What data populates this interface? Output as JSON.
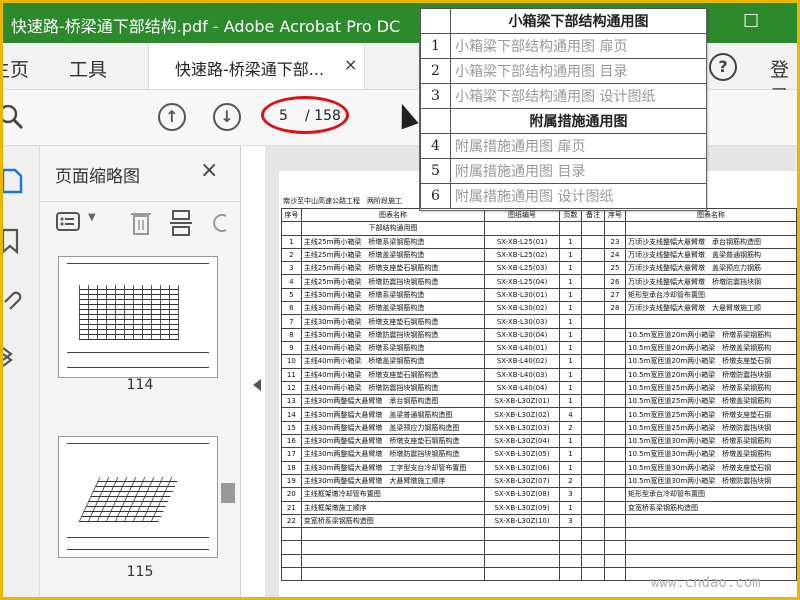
{
  "window": {
    "title": "快速路-桥梁通下部结构.pdf - Adobe Acrobat Pro DC",
    "maximize_glyph": "☐"
  },
  "tabs": {
    "home": "主页",
    "tools": "工具",
    "doc_tab": "快速路-桥梁通下部...",
    "doc_close": "×",
    "help": "?",
    "login": "登录"
  },
  "toolbar": {
    "zoom_icon": "search-icon",
    "current_page": "5",
    "total_pages": "/ 158"
  },
  "panel": {
    "title": "页面缩略图",
    "close": "×",
    "thumbnails": [
      {
        "page": "114"
      },
      {
        "page": "115"
      }
    ]
  },
  "overlay": {
    "rows": [
      {
        "num": "",
        "text": "小箱梁下部结构通用图",
        "section": true
      },
      {
        "num": "1",
        "text": "小箱梁下部结构通用图 扉页"
      },
      {
        "num": "2",
        "text": "小箱梁下部结构通用图 目录"
      },
      {
        "num": "3",
        "text": "小箱梁下部结构通用图 设计图纸"
      },
      {
        "num": "",
        "text": "附属措施通用图",
        "section": true
      },
      {
        "num": "4",
        "text": "附属措施通用图 扉页"
      },
      {
        "num": "5",
        "text": "附属措施通用图 目录"
      },
      {
        "num": "6",
        "text": "附属措施通用图 设计图纸"
      }
    ]
  },
  "doc": {
    "header_left": "南沙至中山高速公路工程　两阶段施工",
    "headers": [
      "序号",
      "图表名称",
      "图纸编号",
      "页数",
      "备注",
      "序号",
      "图表名称"
    ],
    "section_title": "下部结构通用图",
    "rows_left": [
      [
        "1",
        "主线25m两小箱梁　桥墩系梁钢筋构造",
        "SX-XB-L25(01)",
        "1"
      ],
      [
        "2",
        "主线25m两小箱梁　桥墩盖梁钢筋构造",
        "SX-XB-L25(02)",
        "1"
      ],
      [
        "3",
        "主线25m两小箱梁　桥墩支座垫石钢筋构造",
        "SX-XB-L25(03)",
        "1"
      ],
      [
        "4",
        "主线25m两小箱梁　桥墩防震挡块钢筋构造",
        "SX-XB-L25(04)",
        "1"
      ],
      [
        "5",
        "主线30m两小箱梁　桥墩系梁钢筋构造",
        "SX-XB-L30(01)",
        "1"
      ],
      [
        "6",
        "主线30m两小箱梁　桥墩盖梁钢筋构造",
        "SX-XB-L30(02)",
        "1"
      ],
      [
        "7",
        "主线30m两小箱梁　桥墩支座垫石钢筋构造",
        "SX-XB-L30(03)",
        "1"
      ],
      [
        "8",
        "主线30m两小箱梁　桥墩防震挡块钢筋构造",
        "SX-XB-L30(04)",
        "1"
      ],
      [
        "9",
        "主线40m两小箱梁　桥墩系梁钢筋构造",
        "SX-XB-L40(01)",
        "1"
      ],
      [
        "10",
        "主线40m两小箱梁　桥墩盖梁钢筋构造",
        "SX-XB-L40(02)",
        "1"
      ],
      [
        "11",
        "主线40m两小箱梁　桥墩支座垫石钢筋构造",
        "SX-XB-L40(03)",
        "1"
      ],
      [
        "12",
        "主线40m两小箱梁　桥墩防震挡块钢筋构造",
        "SX-XB-L40(04)",
        "1"
      ],
      [
        "13",
        "主线30m两整幅大悬臂墩　承台钢筋构造图",
        "SX-XB-L30Z(01)",
        "1"
      ],
      [
        "14",
        "主线30m两整幅大悬臂墩　盖梁普通钢筋构造图",
        "SX-XB-L30Z(02)",
        "4"
      ],
      [
        "15",
        "主线30m两整幅大悬臂墩　盖梁预应力钢筋构造图",
        "SX-XB-L30Z(03)",
        "2"
      ],
      [
        "16",
        "主线30m两整幅大悬臂墩　桥墩支座垫石钢筋构造",
        "SX-XB-L30Z(04)",
        "1"
      ],
      [
        "17",
        "主线30m两整幅大悬臂墩　桥墩防震挡块钢筋构造",
        "SX-XB-L30Z(05)",
        "1"
      ],
      [
        "18",
        "主线30m两整幅大悬臂墩　工字型支台冷却管布置图",
        "SX-XB-L30Z(06)",
        "1"
      ],
      [
        "19",
        "主线30m两整幅大悬臂墩　大悬臂墩施工顺序",
        "SX-XB-L30Z(07)",
        "2"
      ],
      [
        "20",
        "主线框架墩冷却管布置图",
        "SX-XB-L30Z(08)",
        "3"
      ],
      [
        "21",
        "主线框架墩施工顺序",
        "SX-XB-L30Z(09)",
        "1"
      ],
      [
        "22",
        "变宽桥系梁钢筋构造图",
        "SX-XB-L30Z(10)",
        "3"
      ]
    ],
    "rows_right": [
      [
        "23",
        "万顷沙支线整幅大悬臂墩　承台钢筋构造图"
      ],
      [
        "24",
        "万顷沙支线整幅大悬臂墩　盖梁普通钢筋构"
      ],
      [
        "25",
        "万顷沙支线整幅大悬臂墩　盖梁预应力钢筋"
      ],
      [
        "26",
        "万顷沙支线整幅大悬臂墩　桥墩防震挡块钢"
      ],
      [
        "27",
        "矩形型承台冷却管布置图"
      ],
      [
        "28",
        "万顷沙支线整幅大悬臂墩　大悬臂墩施工顺"
      ],
      [
        "",
        ""
      ],
      [
        "",
        "10.5m宽匝道20m两小箱梁　桥墩系梁钢筋构"
      ],
      [
        "",
        "10.5m宽匝道20m两小箱梁　桥墩盖梁钢筋构"
      ],
      [
        "",
        "10.5m宽匝道20m两小箱梁　桥墩支座垫石钢"
      ],
      [
        "",
        "10.5m宽匝道20m两小箱梁　桥墩防震挡块钢"
      ],
      [
        "",
        "10.5m宽匝道25m两小箱梁　桥墩系梁钢筋构"
      ],
      [
        "",
        "10.5m宽匝道25m两小箱梁　桥墩盖梁钢筋构"
      ],
      [
        "",
        "10.5m宽匝道25m两小箱梁　桥墩支座垫石钢"
      ],
      [
        "",
        "10.5m宽匝道25m两小箱梁　桥墩防震挡块钢"
      ],
      [
        "",
        "10.5m宽匝道30m两小箱梁　桥墩系梁钢筋构"
      ],
      [
        "",
        "10.5m宽匝道30m两小箱梁　桥墩盖梁钢筋构"
      ],
      [
        "",
        "10.5m宽匝道30m两小箱梁　桥墩支座垫石钢"
      ],
      [
        "",
        "10.5m宽匝道30m两小箱梁　桥墩防震挡块钢"
      ],
      [
        "",
        "矩形型承台冷却管布置图"
      ],
      [
        "",
        "变宽桥系梁钢筋构造图"
      ],
      [
        "",
        ""
      ]
    ]
  },
  "watermark": "www.cndao.com",
  "colors": {
    "titlebar": "#2c8a2c",
    "border": "#e8b800",
    "annotation": "#e01010"
  }
}
